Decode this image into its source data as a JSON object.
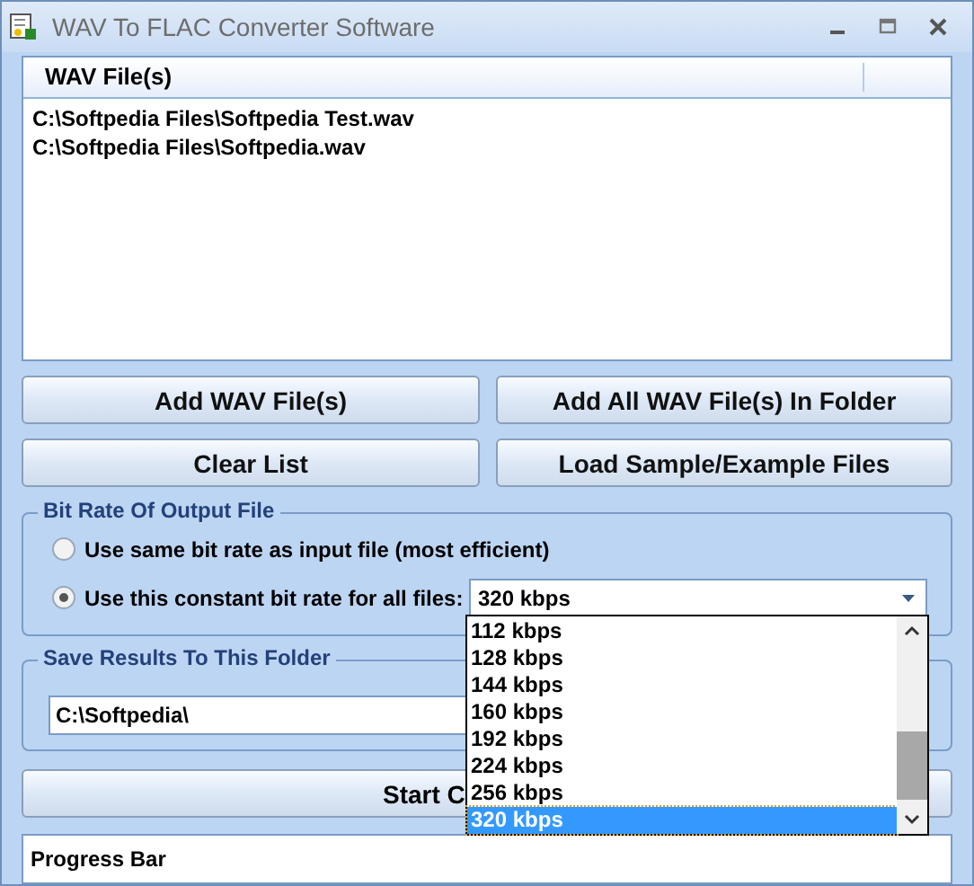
{
  "window": {
    "title": "WAV To FLAC Converter Software"
  },
  "file_list": {
    "columns": [
      "WAV File(s)"
    ],
    "rows": [
      "C:\\Softpedia Files\\Softpedia Test.wav",
      "C:\\Softpedia Files\\Softpedia.wav"
    ]
  },
  "buttons": [
    {
      "label": "Add WAV File(s)"
    },
    {
      "label": "Add All WAV File(s) In Folder"
    },
    {
      "label": "Clear List"
    },
    {
      "label": "Load Sample/Example Files"
    }
  ],
  "bit_rate": {
    "title": "Bit Rate Of Output File",
    "options": [
      {
        "label": "Use same bit rate as input file (most efficient)",
        "selected": false
      },
      {
        "label": "Use this constant bit rate for all files:",
        "selected": true
      }
    ],
    "combo_value": "320 kbps",
    "dropdown": [
      {
        "label": "112 kbps",
        "selected": false
      },
      {
        "label": "128 kbps",
        "selected": false
      },
      {
        "label": "144 kbps",
        "selected": false
      },
      {
        "label": "160 kbps",
        "selected": false
      },
      {
        "label": "192 kbps",
        "selected": false
      },
      {
        "label": "224 kbps",
        "selected": false
      },
      {
        "label": "256 kbps",
        "selected": false
      },
      {
        "label": "320 kbps",
        "selected": true
      }
    ]
  },
  "save_folder": {
    "title": "Save Results To This Folder",
    "value": "C:\\Softpedia\\"
  },
  "start_button": {
    "label": "Start C"
  },
  "progress_bar": {
    "label": "Progress Bar",
    "level": 0
  }
}
